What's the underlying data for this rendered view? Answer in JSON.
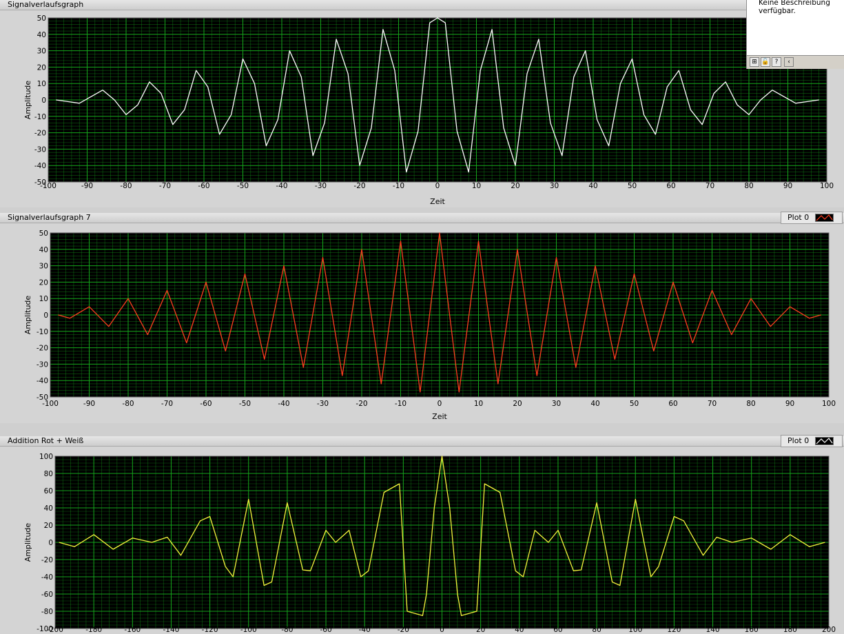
{
  "help_window": {
    "text": "Keine Beschreibung verfügbar.",
    "buttons": [
      {
        "icon": "context-help-icon",
        "glyph": "⊞"
      },
      {
        "icon": "lock-icon",
        "glyph": "🔓"
      },
      {
        "icon": "question-icon",
        "glyph": "?"
      },
      {
        "icon": "chevron-left-icon",
        "glyph": "‹"
      }
    ]
  },
  "colors": {
    "plot_bg": "#000000",
    "grid": "#15a51b",
    "white_trace": "#ffffff",
    "red_trace": "#ff3c1f",
    "yellow_trace": "#f5f53c"
  },
  "chart_data": [
    {
      "type": "line",
      "title": "Signalverlaufsgraph",
      "xlabel": "Zeit",
      "ylabel": "Amplitude",
      "xlim": [
        -100,
        100
      ],
      "ylim": [
        -50,
        50
      ],
      "xticks": [
        -100,
        -90,
        -80,
        -70,
        -60,
        -50,
        -40,
        -30,
        -20,
        -10,
        0,
        10,
        20,
        30,
        40,
        50,
        60,
        70,
        80,
        90,
        100
      ],
      "yticks": [
        50,
        40,
        30,
        20,
        10,
        0,
        -10,
        -20,
        -30,
        -40,
        -50
      ],
      "grid": true,
      "legend": null,
      "series": [
        {
          "color": "#ffffff",
          "x": [
            -98,
            -95,
            -92,
            -89,
            -86,
            -83,
            -80,
            -77,
            -74,
            -71,
            -68,
            -65,
            -62,
            -59,
            -56,
            -53,
            -50,
            -47,
            -44,
            -41,
            -38,
            -35,
            -32,
            -29,
            -26,
            -23,
            -20,
            -17,
            -14,
            -11,
            -8,
            -5,
            -2,
            0,
            2,
            5,
            8,
            11,
            14,
            17,
            20,
            23,
            26,
            29,
            32,
            35,
            38,
            41,
            44,
            47,
            50,
            53,
            56,
            59,
            62,
            65,
            68,
            71,
            74,
            77,
            80,
            83,
            86,
            89,
            92,
            95,
            98
          ],
          "y": [
            0,
            -1,
            -2,
            2,
            6,
            0,
            -9,
            -3,
            11,
            4,
            -15,
            -6,
            18,
            8,
            -21,
            -9,
            25,
            10,
            -28,
            -12,
            30,
            14,
            -34,
            -14,
            37,
            16,
            -40,
            -17,
            43,
            18,
            -44,
            -19,
            47,
            50,
            47,
            -19,
            -44,
            18,
            43,
            -17,
            -40,
            16,
            37,
            -14,
            -34,
            14,
            30,
            -12,
            -28,
            10,
            25,
            -9,
            -21,
            8,
            18,
            -6,
            -15,
            4,
            11,
            -3,
            -9,
            0,
            6,
            2,
            -2,
            -1,
            0
          ]
        }
      ]
    },
    {
      "type": "line",
      "title": "Signalverlaufsgraph 7",
      "xlabel": "Zeit",
      "ylabel": "Amplitude",
      "xlim": [
        -100,
        100
      ],
      "ylim": [
        -50,
        50
      ],
      "xticks": [
        -100,
        -90,
        -80,
        -70,
        -60,
        -50,
        -40,
        -30,
        -20,
        -10,
        0,
        10,
        20,
        30,
        40,
        50,
        60,
        70,
        80,
        90,
        100
      ],
      "yticks": [
        50,
        40,
        30,
        20,
        10,
        0,
        -10,
        -20,
        -30,
        -40,
        -50
      ],
      "grid": true,
      "legend": "top-right",
      "series": [
        {
          "name": "Plot 0",
          "color": "#ff3c1f",
          "x": [
            -98,
            -95,
            -90,
            -85,
            -80,
            -75,
            -70,
            -65,
            -60,
            -55,
            -50,
            -45,
            -40,
            -35,
            -30,
            -25,
            -20,
            -15,
            -10,
            -5,
            0,
            5,
            10,
            15,
            20,
            25,
            30,
            35,
            40,
            45,
            50,
            55,
            60,
            65,
            70,
            75,
            80,
            85,
            90,
            95,
            98
          ],
          "y": [
            0,
            -2,
            5,
            -7,
            10,
            -12,
            15,
            -17,
            20,
            -22,
            25,
            -27,
            30,
            -32,
            35,
            -37,
            40,
            -42,
            45,
            -47,
            50,
            -47,
            45,
            -42,
            40,
            -37,
            35,
            -32,
            30,
            -27,
            25,
            -22,
            20,
            -17,
            15,
            -12,
            10,
            -7,
            5,
            -2,
            0
          ]
        }
      ]
    },
    {
      "type": "line",
      "title": "Addition Rot + Weiß",
      "xlabel": "",
      "ylabel": "Amplitude",
      "xlim": [
        -200,
        200
      ],
      "ylim": [
        -100,
        100
      ],
      "xticks": [
        -200,
        -180,
        -160,
        -140,
        -120,
        -100,
        -80,
        -60,
        -40,
        -20,
        0,
        20,
        40,
        60,
        80,
        100,
        120,
        140,
        160,
        180,
        200
      ],
      "yticks": [
        100,
        80,
        60,
        40,
        20,
        0,
        -20,
        -40,
        -60,
        -80,
        -100
      ],
      "grid": true,
      "legend": "top-right",
      "series": [
        {
          "name": "Plot 0",
          "color": "#f5f53c",
          "x": [
            -198,
            -190,
            -180,
            -170,
            -160,
            -150,
            -142,
            -135,
            -125,
            -120,
            -112,
            -108,
            -100,
            -92,
            -88,
            -80,
            -72,
            -68,
            -60,
            -55,
            -48,
            -42,
            -38,
            -30,
            -22,
            -18,
            -10,
            -8,
            -4,
            0,
            4,
            8,
            10,
            18,
            22,
            30,
            38,
            42,
            48,
            55,
            60,
            68,
            72,
            80,
            88,
            92,
            100,
            108,
            112,
            120,
            125,
            135,
            142,
            150,
            160,
            170,
            180,
            190,
            198
          ],
          "y": [
            0,
            -5,
            9,
            -8,
            5,
            0,
            6,
            -15,
            25,
            30,
            -28,
            -40,
            50,
            -50,
            -46,
            46,
            -32,
            -33,
            14,
            0,
            14,
            -40,
            -33,
            58,
            68,
            -80,
            -85,
            -60,
            40,
            100,
            40,
            -60,
            -85,
            -80,
            68,
            58,
            -33,
            -40,
            14,
            0,
            14,
            -33,
            -32,
            46,
            -46,
            -50,
            50,
            -40,
            -28,
            30,
            25,
            -15,
            6,
            0,
            5,
            -8,
            9,
            -5,
            0
          ]
        }
      ]
    }
  ]
}
